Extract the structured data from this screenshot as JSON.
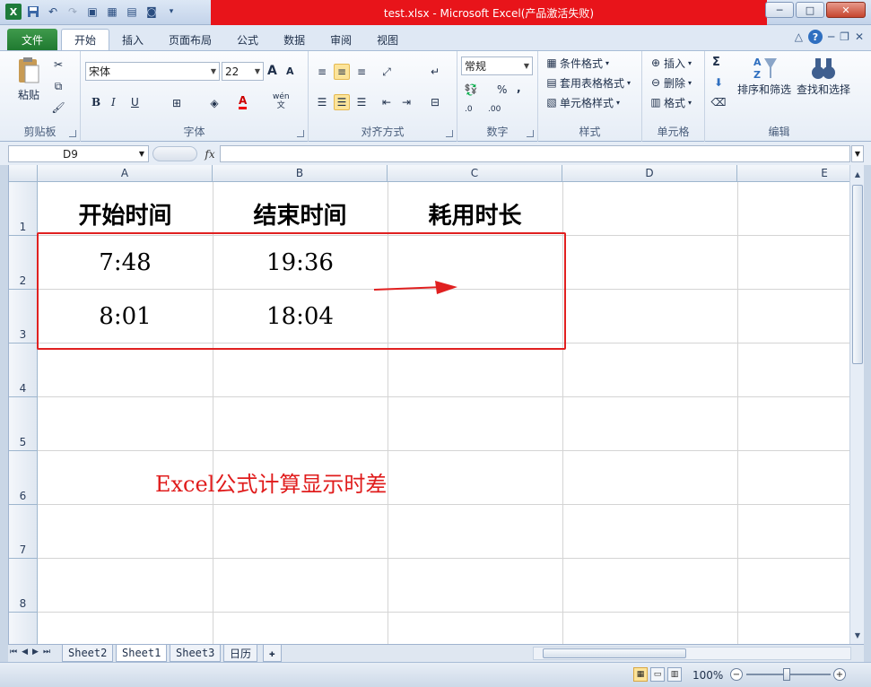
{
  "window": {
    "title": "test.xlsx - Microsoft Excel(产品激活失败)",
    "minimize": "─",
    "maximize": "□",
    "close": "✕"
  },
  "tabs": {
    "file": "文件",
    "items": [
      "开始",
      "插入",
      "页面布局",
      "公式",
      "数据",
      "审阅",
      "视图"
    ],
    "active_index": 0
  },
  "ribbon": {
    "clipboard": {
      "label": "剪贴板",
      "paste": "粘贴"
    },
    "font": {
      "label": "字体",
      "name": "宋体",
      "size": "22",
      "grow": "A",
      "shrink": "A",
      "bold": "B",
      "italic": "I",
      "underline": "U",
      "font_color_letter": "A",
      "wen": "wén"
    },
    "alignment": {
      "label": "对齐方式"
    },
    "number": {
      "label": "数字",
      "format": "常规",
      "percent": "%",
      "comma": ",",
      "inc": ".0",
      "dec": ".00"
    },
    "styles": {
      "label": "样式",
      "conditional": "条件格式",
      "table": "套用表格格式",
      "cell_style": "单元格样式"
    },
    "cells": {
      "label": "单元格",
      "insert": "插入",
      "delete": "删除",
      "format": "格式"
    },
    "editing": {
      "label": "编辑",
      "sum": "Σ",
      "sort": "排序和筛选",
      "find": "查找和选择"
    }
  },
  "formula_bar": {
    "name_box": "D9",
    "fx": "fx",
    "value": ""
  },
  "columns": [
    "A",
    "B",
    "C",
    "D",
    "E"
  ],
  "rows": [
    "1",
    "2",
    "3",
    "4",
    "5",
    "6",
    "7",
    "8"
  ],
  "cells": {
    "A1": "开始时间",
    "B1": "结束时间",
    "C1": "耗用时长",
    "A2": "7:48",
    "B2": "19:36",
    "A3": "8:01",
    "B3": "18:04"
  },
  "annotation": "Excel公式计算显示时差",
  "colors": {
    "highlight_box": "#e02020",
    "annotation_text": "#e01c1c",
    "title_bar": "#e8141a"
  },
  "sheets": [
    "Sheet2",
    "Sheet1",
    "Sheet3",
    "日历"
  ],
  "active_sheet_index": 1,
  "status": {
    "zoom": "100%",
    "zoom_fraction": 0.5
  }
}
